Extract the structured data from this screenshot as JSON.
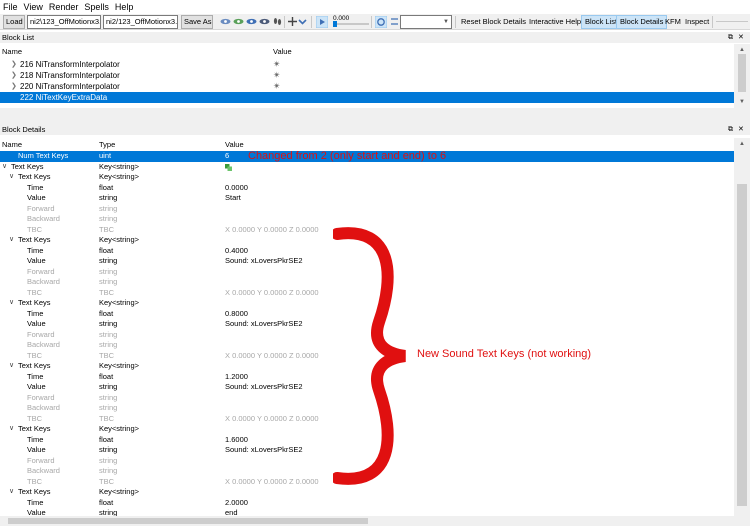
{
  "menu": [
    "File",
    "View",
    "Render",
    "Spells",
    "Help"
  ],
  "toolbar": {
    "load_label": "Load",
    "load_path": "ni2\\123_OffMotionx3.kf",
    "save_path": "ni2/123_OffMotionx3.kf",
    "save_as_label": "Save As",
    "slider_value": "0.000",
    "reset_block_details": "Reset Block Details",
    "interactive_help": "Interactive Help",
    "block_list": "Block List",
    "block_details": "Block Details",
    "kfm": "KFM",
    "inspect": "Inspect"
  },
  "block_list": {
    "title": "Block List",
    "col_name": "Name",
    "col_value": "Value",
    "rows": [
      {
        "label": "216 NiTransformInterpolator",
        "selected": false
      },
      {
        "label": "218 NiTransformInterpolator",
        "selected": false
      },
      {
        "label": "220 NiTransformInterpolator",
        "selected": false
      },
      {
        "label": "222 NiTextKeyExtraData",
        "selected": true
      }
    ]
  },
  "block_details": {
    "title": "Block Details",
    "col_name": "Name",
    "col_type": "Type",
    "col_value": "Value",
    "rows": [
      {
        "indent": 1,
        "name": "Num Text Keys",
        "type": "uint",
        "value": "6",
        "selected": true
      },
      {
        "indent": 0,
        "tw": true,
        "name": "Text Keys",
        "type": "Key<string>",
        "value": "",
        "green": true
      },
      {
        "indent": 1,
        "tw": true,
        "name": "Text Keys",
        "type": "Key<string>",
        "value": ""
      },
      {
        "indent": 2,
        "name": "Time",
        "type": "float",
        "value": "0.0000"
      },
      {
        "indent": 2,
        "name": "Value",
        "type": "string",
        "value": "Start"
      },
      {
        "indent": 2,
        "name": "Forward",
        "type": "string",
        "value": "",
        "dim": true
      },
      {
        "indent": 2,
        "name": "Backward",
        "type": "string",
        "value": "",
        "dim": true
      },
      {
        "indent": 2,
        "name": "TBC",
        "type": "TBC",
        "value": "X 0.0000 Y 0.0000 Z 0.0000",
        "dim": true
      },
      {
        "indent": 1,
        "tw": true,
        "name": "Text Keys",
        "type": "Key<string>",
        "value": ""
      },
      {
        "indent": 2,
        "name": "Time",
        "type": "float",
        "value": "0.4000"
      },
      {
        "indent": 2,
        "name": "Value",
        "type": "string",
        "value": "Sound: xLoversPkrSE2"
      },
      {
        "indent": 2,
        "name": "Forward",
        "type": "string",
        "value": "",
        "dim": true
      },
      {
        "indent": 2,
        "name": "Backward",
        "type": "string",
        "value": "",
        "dim": true
      },
      {
        "indent": 2,
        "name": "TBC",
        "type": "TBC",
        "value": "X 0.0000 Y 0.0000 Z 0.0000",
        "dim": true
      },
      {
        "indent": 1,
        "tw": true,
        "name": "Text Keys",
        "type": "Key<string>",
        "value": ""
      },
      {
        "indent": 2,
        "name": "Time",
        "type": "float",
        "value": "0.8000"
      },
      {
        "indent": 2,
        "name": "Value",
        "type": "string",
        "value": "Sound: xLoversPkrSE2"
      },
      {
        "indent": 2,
        "name": "Forward",
        "type": "string",
        "value": "",
        "dim": true
      },
      {
        "indent": 2,
        "name": "Backward",
        "type": "string",
        "value": "",
        "dim": true
      },
      {
        "indent": 2,
        "name": "TBC",
        "type": "TBC",
        "value": "X 0.0000 Y 0.0000 Z 0.0000",
        "dim": true
      },
      {
        "indent": 1,
        "tw": true,
        "name": "Text Keys",
        "type": "Key<string>",
        "value": ""
      },
      {
        "indent": 2,
        "name": "Time",
        "type": "float",
        "value": "1.2000"
      },
      {
        "indent": 2,
        "name": "Value",
        "type": "string",
        "value": "Sound: xLoversPkrSE2"
      },
      {
        "indent": 2,
        "name": "Forward",
        "type": "string",
        "value": "",
        "dim": true
      },
      {
        "indent": 2,
        "name": "Backward",
        "type": "string",
        "value": "",
        "dim": true
      },
      {
        "indent": 2,
        "name": "TBC",
        "type": "TBC",
        "value": "X 0.0000 Y 0.0000 Z 0.0000",
        "dim": true
      },
      {
        "indent": 1,
        "tw": true,
        "name": "Text Keys",
        "type": "Key<string>",
        "value": ""
      },
      {
        "indent": 2,
        "name": "Time",
        "type": "float",
        "value": "1.6000"
      },
      {
        "indent": 2,
        "name": "Value",
        "type": "string",
        "value": "Sound: xLoversPkrSE2"
      },
      {
        "indent": 2,
        "name": "Forward",
        "type": "string",
        "value": "",
        "dim": true
      },
      {
        "indent": 2,
        "name": "Backward",
        "type": "string",
        "value": "",
        "dim": true
      },
      {
        "indent": 2,
        "name": "TBC",
        "type": "TBC",
        "value": "X 0.0000 Y 0.0000 Z 0.0000",
        "dim": true
      },
      {
        "indent": 1,
        "tw": true,
        "name": "Text Keys",
        "type": "Key<string>",
        "value": ""
      },
      {
        "indent": 2,
        "name": "Time",
        "type": "float",
        "value": "2.0000"
      },
      {
        "indent": 2,
        "name": "Value",
        "type": "string",
        "value": "end"
      }
    ]
  },
  "annotations": {
    "changed_note": "Changed from 2 (only start and end) to 6",
    "brace_note": "New Sound Text Keys (not working)",
    "color": "#e01010"
  },
  "colors": {
    "selection": "#0078d7",
    "toolbar_bg": "#f0f0f0",
    "tab_active_bg": "#cce4f7"
  }
}
